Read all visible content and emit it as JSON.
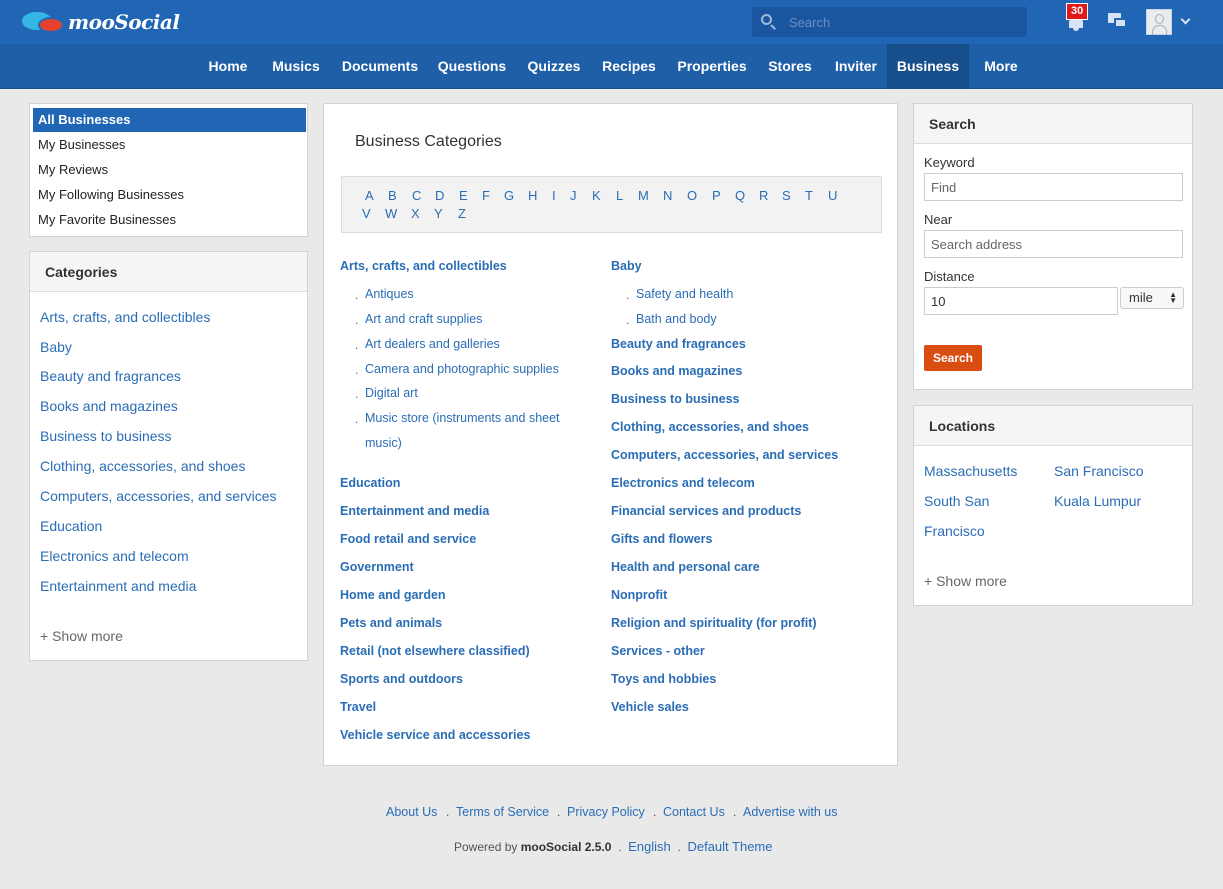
{
  "brand": {
    "name": "mooSocial"
  },
  "header": {
    "search_placeholder": "Search",
    "notification_count": "30"
  },
  "nav": {
    "items": [
      "Home",
      "Musics",
      "Documents",
      "Questions",
      "Quizzes",
      "Recipes",
      "Properties",
      "Stores",
      "Inviter",
      "Business",
      "More"
    ],
    "active": "Business"
  },
  "sidebar_menu": {
    "items": [
      "All Businesses",
      "My Businesses",
      "My Reviews",
      "My Following Businesses",
      "My Favorite Businesses"
    ],
    "active": "All Businesses"
  },
  "categories_panel": {
    "title": "Categories",
    "items": [
      "Arts, crafts, and collectibles",
      "Baby",
      "Beauty and fragrances",
      "Books and magazines",
      "Business to business",
      "Clothing, accessories, and shoes",
      "Computers, accessories, and services",
      "Education",
      "Electronics and telecom",
      "Entertainment and media"
    ],
    "show_more": "+ Show more"
  },
  "main": {
    "title": "Business Categories",
    "alphabet": [
      "A",
      "B",
      "C",
      "D",
      "E",
      "F",
      "G",
      "H",
      "I",
      "J",
      "K",
      "L",
      "M",
      "N",
      "O",
      "P",
      "Q",
      "R",
      "S",
      "T",
      "U",
      "V",
      "W",
      "X",
      "Y",
      "Z"
    ],
    "left_column": {
      "first_heading": "Arts, crafts, and collectibles",
      "first_subs": [
        "Antiques",
        "Art and craft supplies",
        "Art dealers and galleries",
        "Camera and photographic supplies",
        "Digital art",
        "Music store (instruments and sheet",
        "music)"
      ],
      "headings": [
        "Education",
        "Entertainment and media",
        "Food retail and service",
        "Government",
        "Home and garden",
        "Pets and animals",
        "Retail (not elsewhere classified)",
        "Sports and outdoors",
        "Travel",
        "Vehicle service and accessories"
      ]
    },
    "right_column": {
      "first_heading": "Baby",
      "first_subs": [
        "Safety and health",
        "Bath and body"
      ],
      "headings": [
        "Beauty and fragrances",
        "Books and magazines",
        "Business to business",
        "Clothing, accessories, and shoes",
        "Computers, accessories, and services",
        "Electronics and telecom",
        "Financial services and products",
        "Gifts and flowers",
        "Health and personal care",
        "Nonprofit",
        "Religion and spirituality (for profit)",
        "Services - other",
        "Toys and hobbies",
        "Vehicle sales"
      ]
    }
  },
  "search_panel": {
    "title": "Search",
    "keyword_label": "Keyword",
    "keyword_placeholder": "Find",
    "near_label": "Near",
    "near_placeholder": "Search address",
    "distance_label": "Distance",
    "distance_value": "10",
    "unit_value": "mile",
    "button_label": "Search",
    "button_color": "#d94d10"
  },
  "locations_panel": {
    "title": "Locations",
    "items": [
      "Massachusetts",
      "San Francisco",
      "South San",
      "Francisco",
      "Kuala Lumpur"
    ],
    "show_more": "+ Show more"
  },
  "footer": {
    "links": [
      "About Us",
      "Terms of Service",
      "Privacy Policy",
      "Contact Us",
      "Advertise with us"
    ],
    "powered_prefix": "Powered by",
    "powered_name": "mooSocial 2.5.0",
    "language": "English",
    "theme": "Default Theme"
  },
  "colors": {
    "topbar": "#2166b5",
    "nav": "#1f5fa8",
    "link": "#2a6db5",
    "badge": "#e01818"
  }
}
